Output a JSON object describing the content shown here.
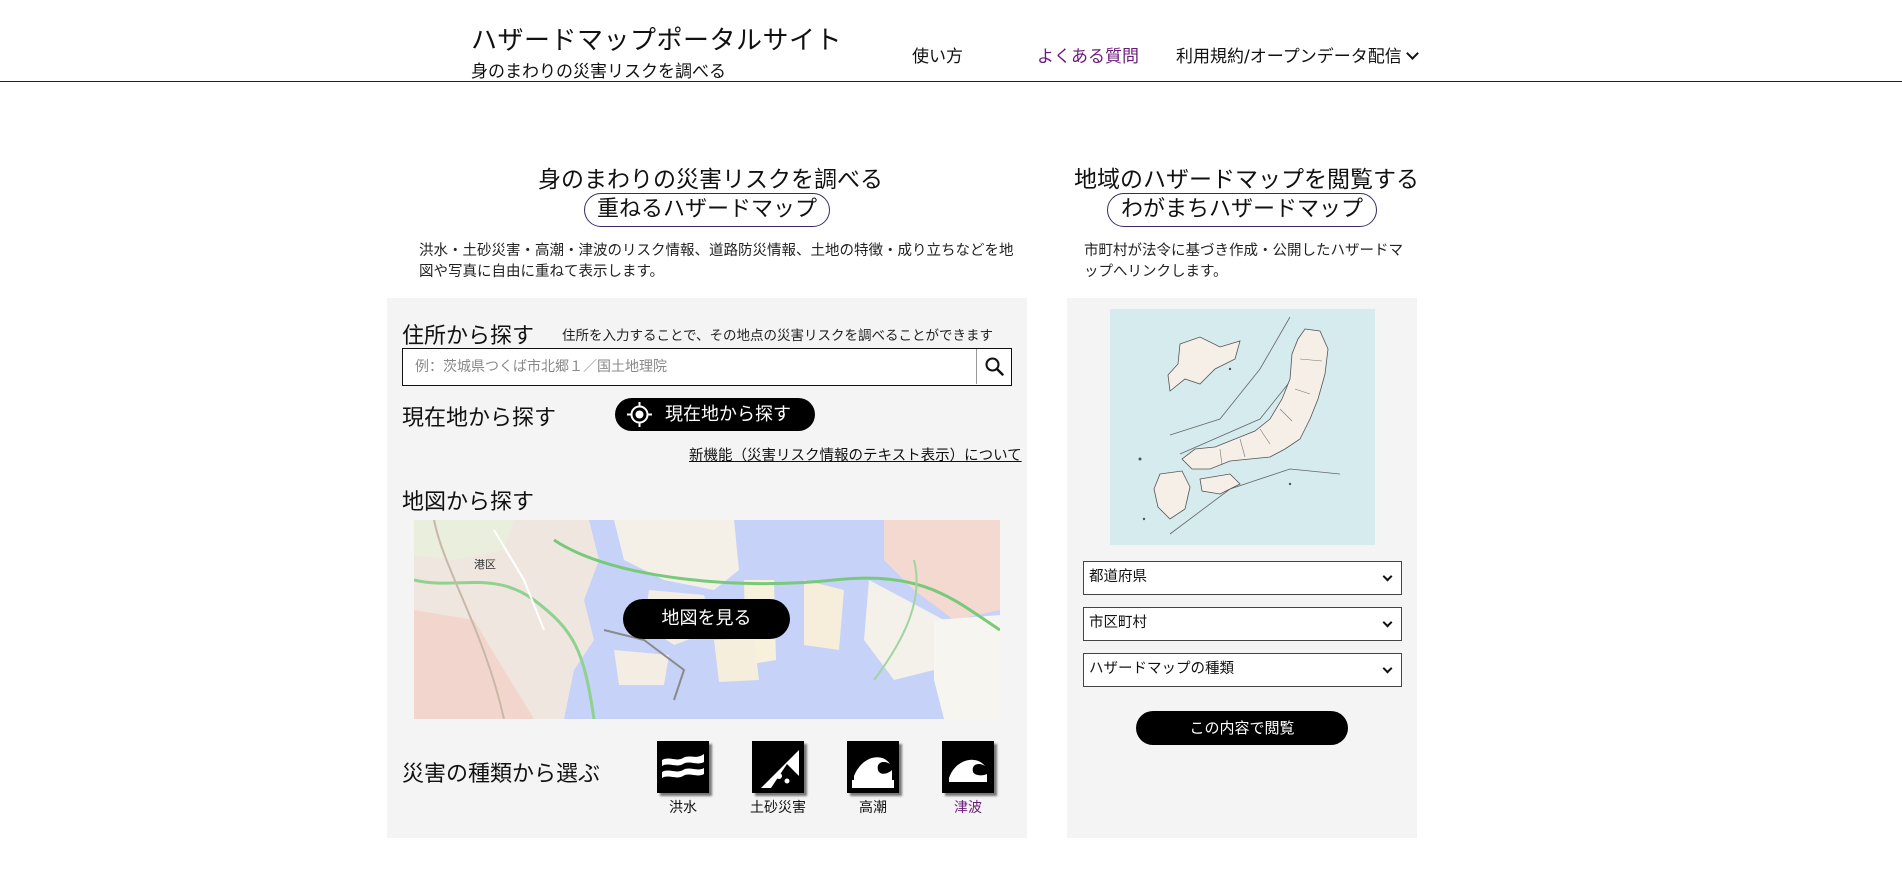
{
  "header": {
    "title": "ハザードマップポータルサイト",
    "subtitle": "身のまわりの災害リスクを調べる",
    "nav": {
      "howto": "使い方",
      "faq": "よくある質問",
      "terms": "利用規約/オープンデータ配信"
    }
  },
  "left": {
    "heading": "身のまわりの災害リスクを調べる",
    "pill": "重ねるハザードマップ",
    "description": [
      "洪水・土砂災害・高潮・津波のリスク情報、道路防災情報、土地の特徴・成り立ちなどを地",
      "図や写真に自由に重ねて表示します。"
    ],
    "address": {
      "label": "住所から探す",
      "hint": "住所を入力することで、その地点の災害リスクを調べることができます",
      "placeholder": "例：茨城県つくば市北郷１／国土地理院"
    },
    "current": {
      "label": "現在地から探す",
      "button": "現在地から探す"
    },
    "new_feature_link": "新機能（災害リスク情報のテキスト表示）について",
    "map": {
      "label": "地図から探す",
      "button": "地図を見る",
      "place_label": "港区"
    },
    "hazards": {
      "label": "災害の種類から選ぶ",
      "items": [
        "洪水",
        "土砂災害",
        "高潮",
        "津波"
      ]
    }
  },
  "right": {
    "heading": "地域のハザードマップを閲覧する",
    "pill": "わがまちハザードマップ",
    "description": [
      "市町村が法令に基づき作成・公開したハザードマ",
      "ップへリンクします。"
    ],
    "selects": {
      "prefecture": "都道府県",
      "municipality": "市区町村",
      "type": "ハザードマップの種類"
    },
    "browse_button": "この内容で閲覧"
  },
  "colors": {
    "visited_link": "#6a1b7a",
    "panel_bg": "#f4f4f4",
    "button_bg": "#000000",
    "pill_border": "#3a2a6a",
    "map_water": "#c6d2f7",
    "japan_sea": "#d5ebee"
  },
  "icons": {
    "search": "magnifier-icon",
    "location": "crosshair-icon",
    "nav_dropdown": "chevron-down-icon",
    "flood": "wave-icon",
    "landslide": "landslide-icon",
    "storm_surge": "big-wave-icon",
    "tsunami": "tsunami-wave-icon"
  }
}
